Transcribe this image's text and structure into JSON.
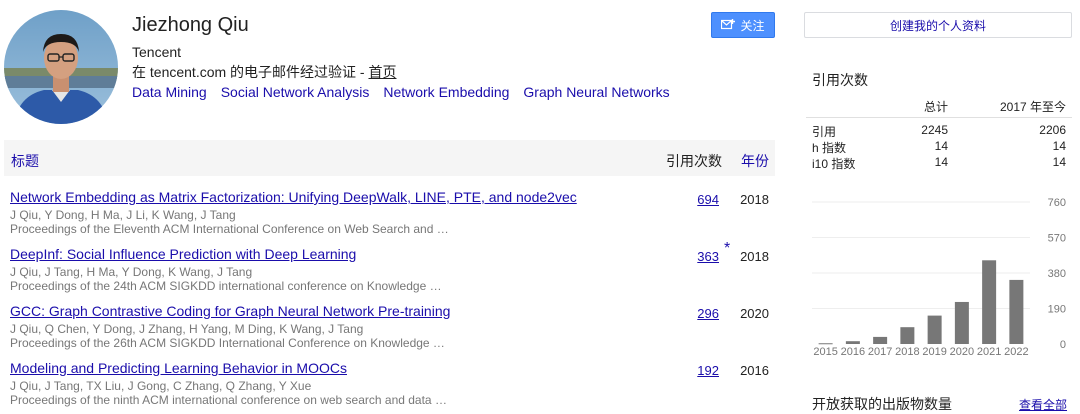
{
  "profile": {
    "name": "Jiezhong Qiu",
    "affiliation": "Tencent",
    "email_text": "在 tencent.com 的电子邮件经过验证 - ",
    "homepage_label": "首页",
    "interests": [
      "Data Mining",
      "Social Network Analysis",
      "Network Embedding",
      "Graph Neural Networks"
    ]
  },
  "actions": {
    "follow_label": "关注",
    "create_profile_label": "创建我的个人资料"
  },
  "table": {
    "header_title": "标题",
    "header_cited": "引用次数",
    "header_year": "年份",
    "rows": [
      {
        "title": "Network Embedding as Matrix Factorization: Unifying DeepWalk, LINE, PTE, and node2vec",
        "authors": "J Qiu, Y Dong, H Ma, J Li, K Wang, J Tang",
        "venue": "Proceedings of the Eleventh ACM International Conference on Web Search and …",
        "cited": "694",
        "star": "",
        "year": "2018"
      },
      {
        "title": "DeepInf: Social Influence Prediction with Deep Learning",
        "authors": "J Qiu, J Tang, H Ma, Y Dong, K Wang, J Tang",
        "venue": "Proceedings of the 24th ACM SIGKDD international conference on Knowledge …",
        "cited": "363",
        "star": "*",
        "year": "2018"
      },
      {
        "title": "GCC: Graph Contrastive Coding for Graph Neural Network Pre-training",
        "authors": "J Qiu, Q Chen, Y Dong, J Zhang, H Yang, M Ding, K Wang, J Tang",
        "venue": "Proceedings of the 26th ACM SIGKDD International Conference on Knowledge …",
        "cited": "296",
        "star": "",
        "year": "2020"
      },
      {
        "title": "Modeling and Predicting Learning Behavior in MOOCs",
        "authors": "J Qiu, J Tang, TX Liu, J Gong, C Zhang, Q Zhang, Y Xue",
        "venue": "Proceedings of the ninth ACM international conference on web search and data …",
        "cited": "192",
        "star": "",
        "year": "2016"
      }
    ]
  },
  "stats": {
    "heading": "引用次数",
    "col_all": "总计",
    "col_since": "2017 年至今",
    "rows": [
      {
        "label": "引用",
        "all": "2245",
        "since": "2206"
      },
      {
        "label": "h 指数",
        "all": "14",
        "since": "14"
      },
      {
        "label": "i10 指数",
        "all": "14",
        "since": "14"
      }
    ]
  },
  "chart_data": {
    "type": "bar",
    "categories": [
      "2015",
      "2016",
      "2017",
      "2018",
      "2019",
      "2020",
      "2021",
      "2022"
    ],
    "values": [
      4,
      15,
      38,
      90,
      152,
      225,
      448,
      343
    ],
    "yticks": [
      0,
      190,
      380,
      570,
      760
    ],
    "ylim": [
      0,
      760
    ],
    "grid": true,
    "bar_color": "#777777"
  },
  "open_access": {
    "heading": "开放获取的出版物数量",
    "view_all_label": "查看全部"
  },
  "colors": {
    "link": "#1a0dab",
    "button": "#4d90fe"
  }
}
